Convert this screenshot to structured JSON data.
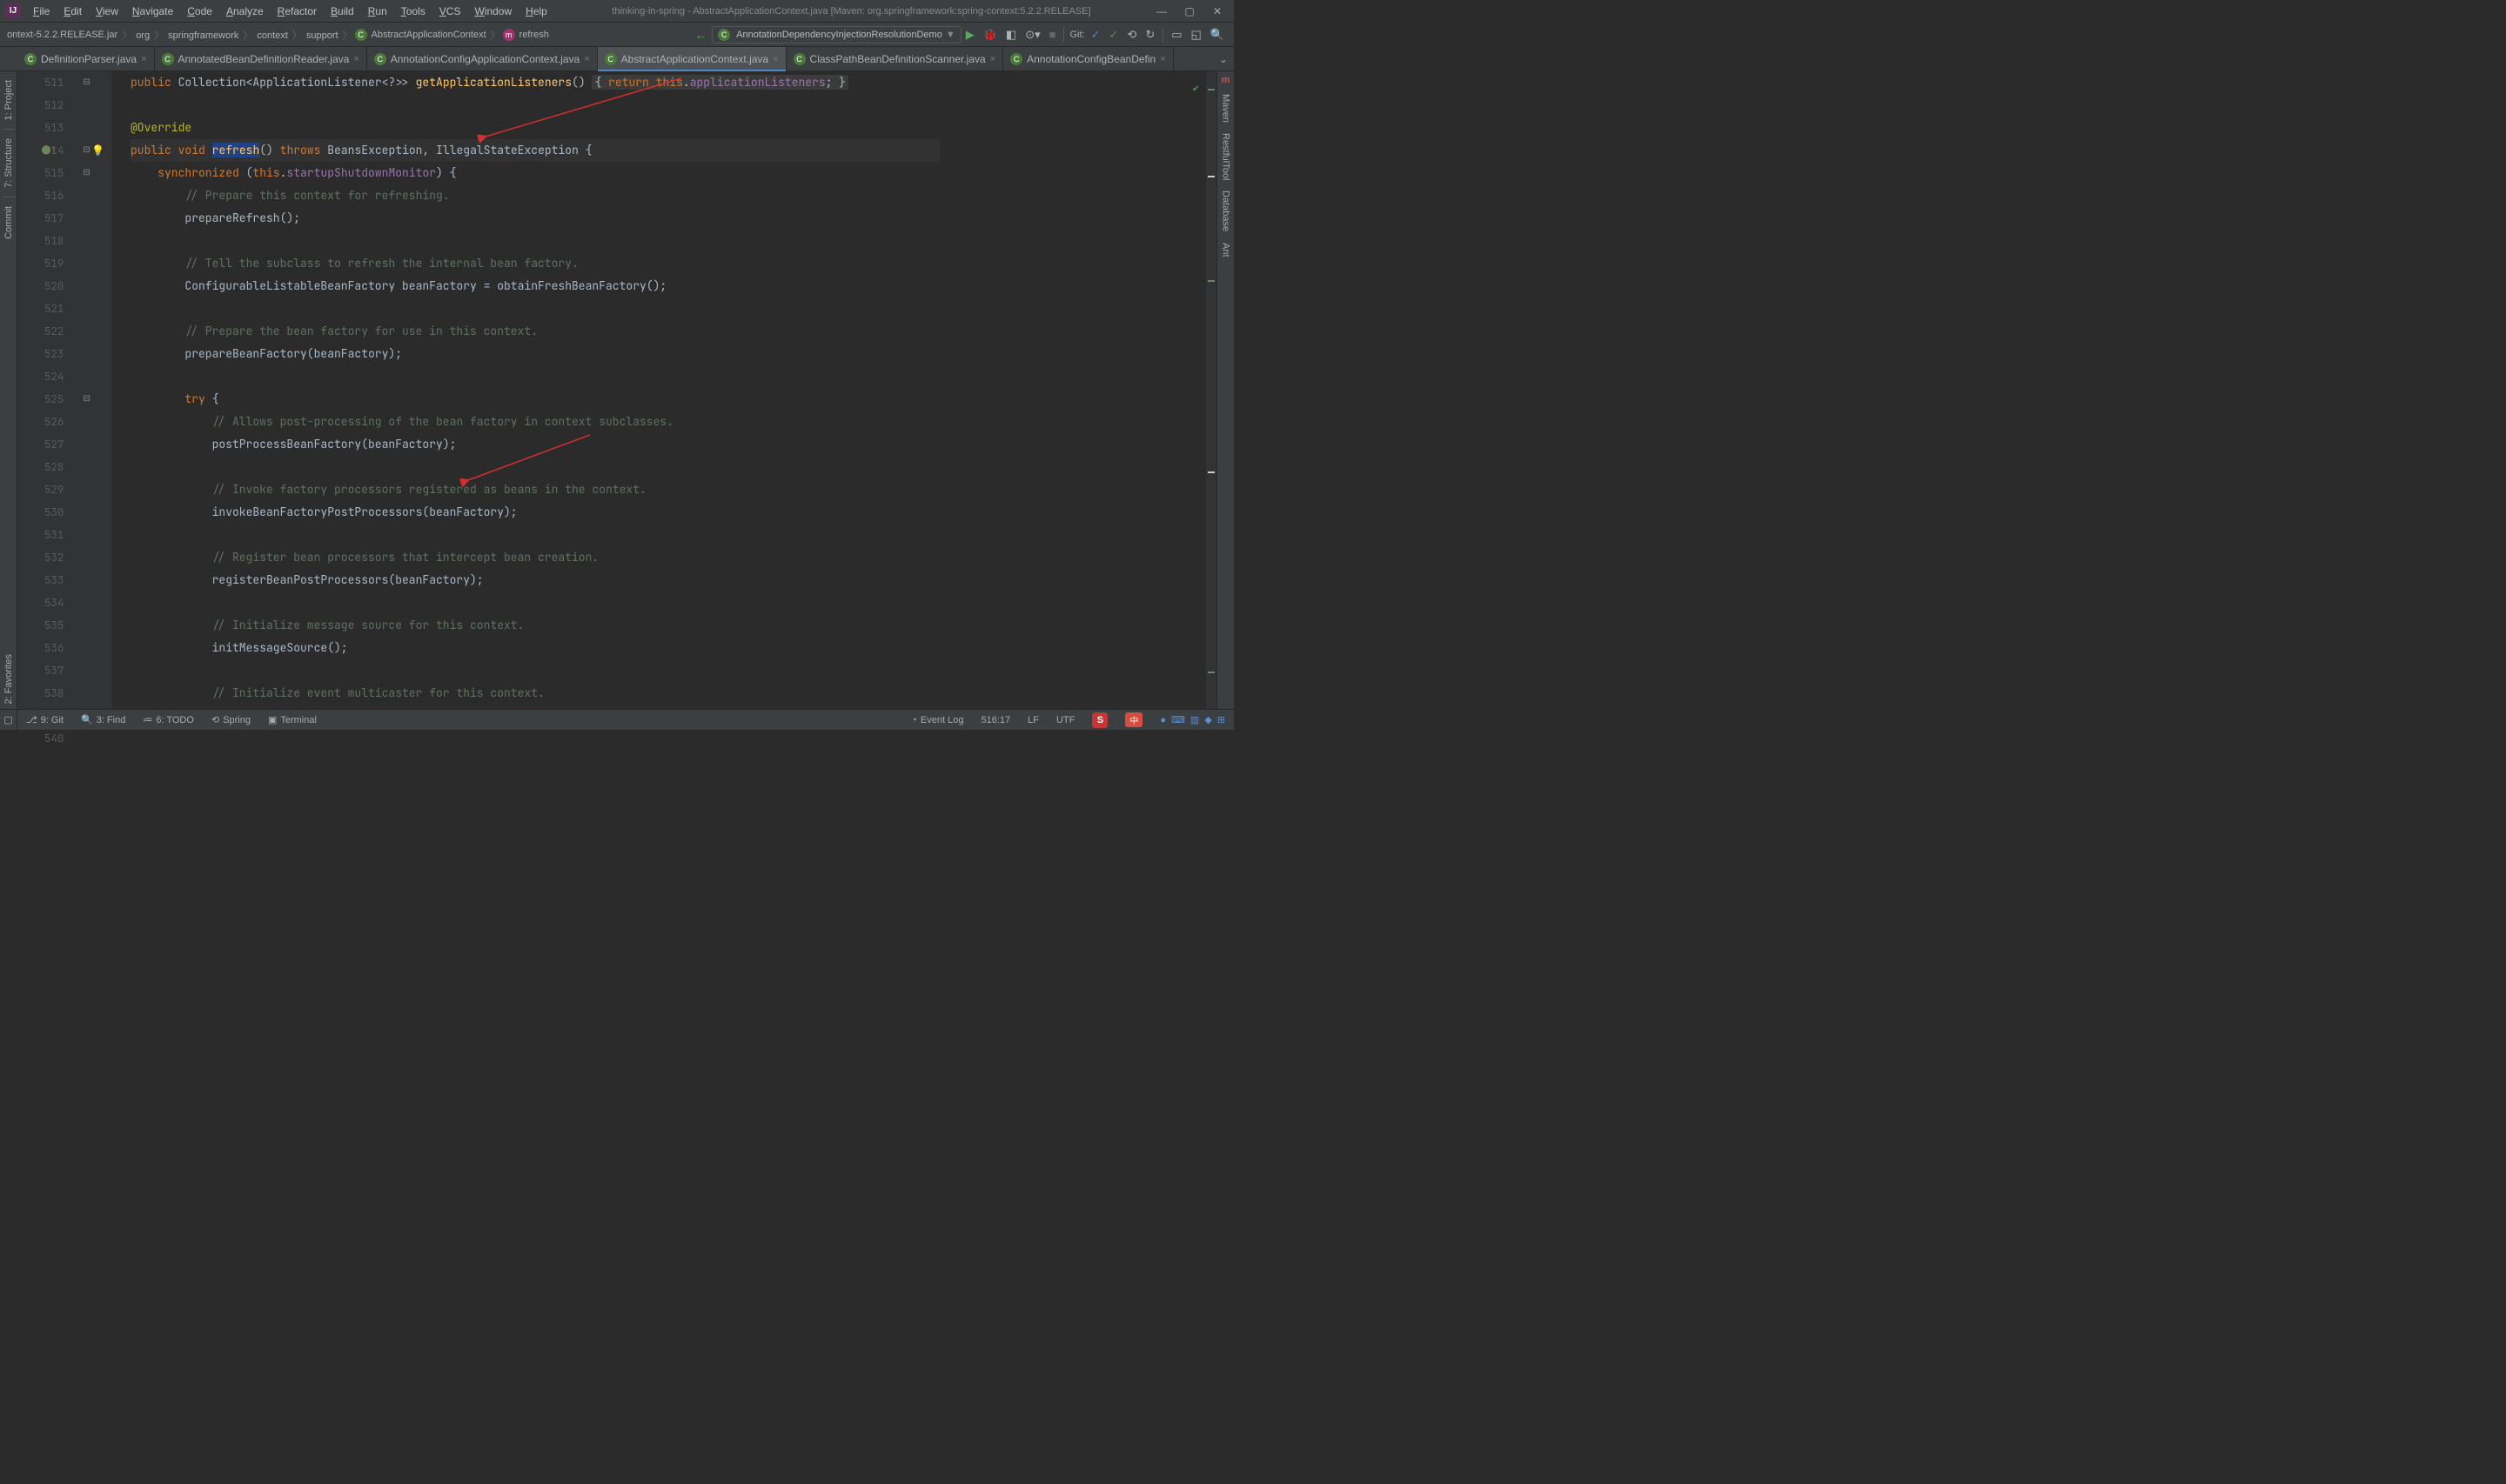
{
  "window_title": "thinking-in-spring - AbstractApplicationContext.java [Maven: org.springframework:spring-context:5.2.2.RELEASE]",
  "menu": [
    "File",
    "Edit",
    "View",
    "Navigate",
    "Code",
    "Analyze",
    "Refactor",
    "Build",
    "Run",
    "Tools",
    "VCS",
    "Window",
    "Help"
  ],
  "breadcrumbs": {
    "jar": "ontext-5.2.2.RELEASE.jar",
    "parts": [
      "org",
      "springframework",
      "context",
      "support"
    ],
    "class": "AbstractApplicationContext",
    "method": "refresh"
  },
  "run_config": "AnnotationDependencyInjectionResolutionDemo",
  "git_label": "Git:",
  "tabs": [
    {
      "label": "DefinitionParser.java",
      "active": false
    },
    {
      "label": "AnnotatedBeanDefinitionReader.java",
      "active": false
    },
    {
      "label": "AnnotationConfigApplicationContext.java",
      "active": false
    },
    {
      "label": "AbstractApplicationContext.java",
      "active": true
    },
    {
      "label": "ClassPathBeanDefinitionScanner.java",
      "active": false
    },
    {
      "label": "AnnotationConfigBeanDefin",
      "active": false
    }
  ],
  "left_tools": [
    "1: Project",
    "7: Structure",
    "Commit",
    "2: Favorites"
  ],
  "right_tools": [
    "Maven",
    "RestfulTool",
    "Database",
    "Ant"
  ],
  "bottom_tools": {
    "git": "9: Git",
    "find": "3: Find",
    "todo": "6: TODO",
    "spring": "Spring",
    "terminal": "Terminal",
    "eventlog": "Event Log"
  },
  "status": {
    "cursor": "516:17",
    "lf": "LF",
    "enc": "UTF",
    "input": "中"
  },
  "first_line_number": 511,
  "line_count": 30,
  "code_lines": [
    {
      "t": "code",
      "html": "<span class='kw'>public</span> Collection&lt;ApplicationListener&lt;?&gt;&gt; <span class='fn'>getApplicationListeners</span>() <span class='ret-hint'>{ <span class='kw'>return</span> <span class='kw'>this</span>.<span class='fld'>applicationListeners</span>; }</span>"
    },
    {
      "t": "blank"
    },
    {
      "t": "code",
      "html": "<span class='ann'>@Override</span>"
    },
    {
      "t": "code",
      "hl": true,
      "html": "<span class='kw'>public</span> <span class='kw'>void</span> <span class='fn' style='background:#214283'>refresh</span>() <span class='kw'>throws</span> BeansException, IllegalStateException {"
    },
    {
      "t": "code",
      "html": "    <span class='kw'>synchronized</span> (<span class='kw'>this</span>.<span class='fld'>startupShutdownMonitor</span>) {"
    },
    {
      "t": "code",
      "html": "        <span class='com'>// Prepare this context for refreshing.</span>"
    },
    {
      "t": "code",
      "html": "        prepareRefresh();"
    },
    {
      "t": "blank"
    },
    {
      "t": "code",
      "html": "        <span class='com'>// Tell the subclass to refresh the internal bean factory.</span>"
    },
    {
      "t": "code",
      "html": "        ConfigurableListableBeanFactory beanFactory = obtainFreshBeanFactory();"
    },
    {
      "t": "blank"
    },
    {
      "t": "code",
      "html": "        <span class='com'>// Prepare the bean factory for use in this context.</span>"
    },
    {
      "t": "code",
      "html": "        prepareBeanFactory(beanFactory);"
    },
    {
      "t": "blank"
    },
    {
      "t": "code",
      "html": "        <span class='kw'>try</span> {"
    },
    {
      "t": "code",
      "html": "            <span class='com'>// Allows post-processing of the bean factory in context subclasses.</span>"
    },
    {
      "t": "code",
      "html": "            postProcessBeanFactory(beanFactory);"
    },
    {
      "t": "blank"
    },
    {
      "t": "code",
      "html": "            <span class='com'>// Invoke factory processors registered as beans in the context.</span>"
    },
    {
      "t": "code",
      "html": "            invokeBeanFactoryPostProcessors(beanFactory);"
    },
    {
      "t": "blank"
    },
    {
      "t": "code",
      "html": "            <span class='com'>// Register bean processors that intercept bean creation.</span>"
    },
    {
      "t": "code",
      "html": "            registerBeanPostProcessors(beanFactory);"
    },
    {
      "t": "blank"
    },
    {
      "t": "code",
      "html": "            <span class='com'>// Initialize message source for this context.</span>"
    },
    {
      "t": "code",
      "html": "            initMessageSource();"
    },
    {
      "t": "blank"
    },
    {
      "t": "code",
      "html": "            <span class='com'>// Initialize event multicaster for this context.</span>"
    }
  ]
}
